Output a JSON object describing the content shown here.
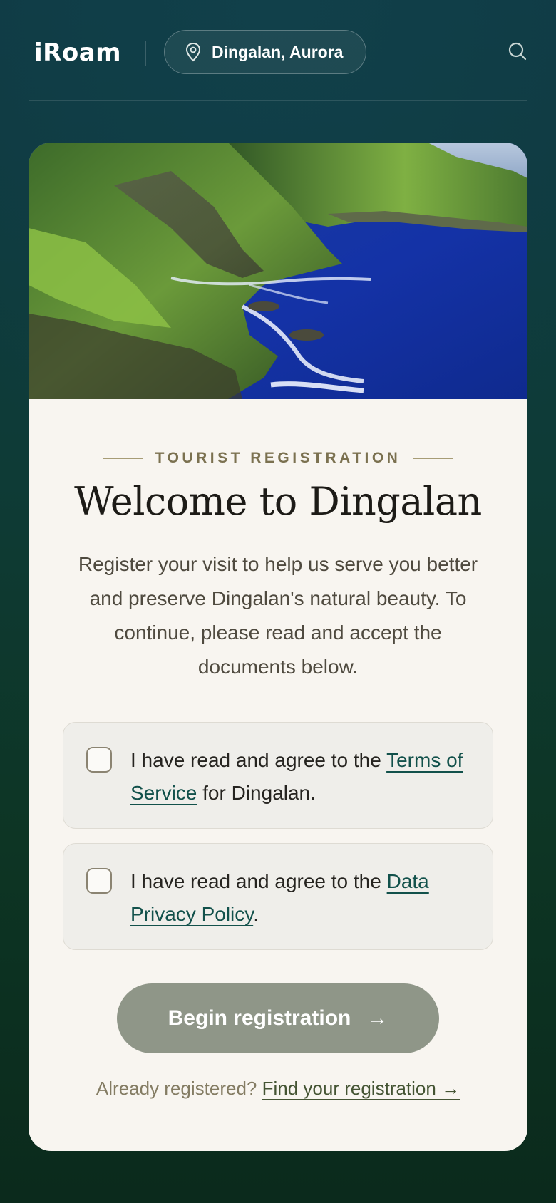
{
  "header": {
    "logo": "iRoam",
    "location": "Dingalan, Aurora",
    "icons": {
      "location": "map-pin-icon",
      "search": "search-icon"
    }
  },
  "card": {
    "hero_alt": "Dingalan coastline with green cliffs and blue sea",
    "eyebrow": "TOURIST REGISTRATION",
    "title": "Welcome to Dingalan",
    "intro": "Register your visit to help us serve you better and preserve Dingalan's natural beauty. To continue, please read and accept the documents below.",
    "consents": [
      {
        "checked": false,
        "prefix": "I have read and agree to the ",
        "link": "Terms of Service",
        "suffix": " for Dingalan."
      },
      {
        "checked": false,
        "prefix": "I have read and agree to the ",
        "link": "Data Privacy Policy",
        "suffix": "."
      }
    ],
    "cta_label": "Begin registration",
    "cta_arrow": "→",
    "footer_prompt": "Already registered?",
    "footer_link": "Find your registration →"
  },
  "colors": {
    "accent": "#12514b",
    "cta_disabled": "#8f9688",
    "card_bg": "#f8f5f0"
  }
}
